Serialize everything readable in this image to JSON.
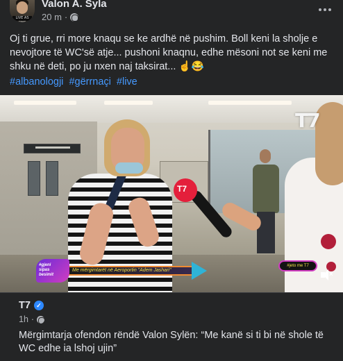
{
  "post": {
    "author": "Valon A. Syla",
    "time": "20 m",
    "separator": "·",
    "avatar_badge": "LIVE AS ONE",
    "text": "Oj ti grue, rri more knaqu se ke ardhë në pushim. Boll keni la sholje e nevojtore të WC'së atje... pushoni knaqnu, edhe mësoni not se keni me shku në deti, po ju nxen naj taksirat... ☝️😂",
    "hashtags": [
      "#albanologji",
      "#gërrnaçi",
      "#live"
    ]
  },
  "video": {
    "channel_logo": "T7",
    "mic_logo": "T7",
    "lower_third_badge": "#gjeni\nsipas\nbesimit",
    "lower_third_caption": "Me mërgimtarët në Aeroportin \"Adem Jashari\"",
    "lower_third_right": "#jeto me T7",
    "mute_icon": "speaker-muted-icon"
  },
  "shared": {
    "source": "T7",
    "time": "1h",
    "separator": "·",
    "headline": "Mërgimtarja ofendon rëndë Valon Sylën: “Me kanë si ti bi në shole të WC edhe ia lshoj ujin”"
  },
  "colors": {
    "background": "#242526",
    "text": "#e4e6eb",
    "muted": "#b0b3b8",
    "link": "#4599ff",
    "verified": "#2d88ff",
    "brand_red": "#e41f3b"
  }
}
